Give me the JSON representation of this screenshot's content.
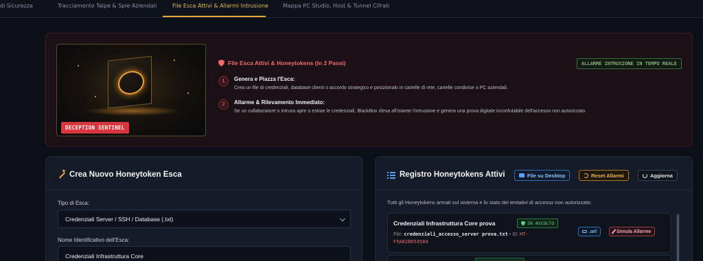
{
  "nav": {
    "tabs": [
      {
        "label": "di Sicurezza"
      },
      {
        "label": "Tracciamento Talpe & Spie Aziendali"
      },
      {
        "label": "File Esca Attivi & Allarmi Intrusione"
      },
      {
        "label": "Mappa PC Studio, Host & Tunnel Cifrati"
      }
    ],
    "active_index": 2
  },
  "hero": {
    "image_badge": "DECEPTION SENTINEL",
    "title": "File Esca Attivi & Honeytokens (In 2 Passi)",
    "tag": "ALLARME INTRUSIONE IN TEMPO REALE",
    "steps": [
      {
        "num": "1",
        "title": "Genera e Piazza l'Esca:",
        "desc": "Crea un file di credenziali, database clienti o accordo strategico e posizionalo in cartelle di rete, cartelle condivise o PC aziendali."
      },
      {
        "num": "2",
        "title": "Allarme & Rilevamento Immediato:",
        "desc": "Se un collaboratore o intruso apre o estrae le credenziali, BlackBox rileva all'istante l'intrusione e genera una prova digitale inconfutabile dell'accesso non autorizzato."
      }
    ]
  },
  "create_panel": {
    "title": "Crea Nuovo Honeytoken Esca",
    "type_label": "Tipo di Esca:",
    "type_value": "Credenziali Server / SSH / Database (.txt)",
    "name_label": "Nome Identificativo dell'Esca:",
    "name_value": "Credenziali Infrastruttura Core"
  },
  "registry_panel": {
    "title": "Registro Honeytokens Attivi",
    "btn_desktop": "File su Desktop",
    "btn_reset": "Reset Allarmi",
    "btn_refresh": "Aggiorna",
    "description": "Tutti gli Honeytokens armati sul sistema e lo stato dei tentativi di accesso non autorizzato:",
    "tokens": [
      {
        "name": "Credenziali Infrastruttura Core prova",
        "status": "IN ASCOLTO",
        "file_label": "File:",
        "file_name": "credenziali_accesso_server prova.txt",
        "id_label": "• ID:",
        "id_value": "HT-F5A82B654584",
        "btn_url": ".url",
        "btn_simulate": "Simula Allarme"
      }
    ]
  },
  "colors": {
    "accent": "#e7a83c",
    "danger": "#f26b6b",
    "success": "#57d28b",
    "info": "#5aa2ff"
  }
}
